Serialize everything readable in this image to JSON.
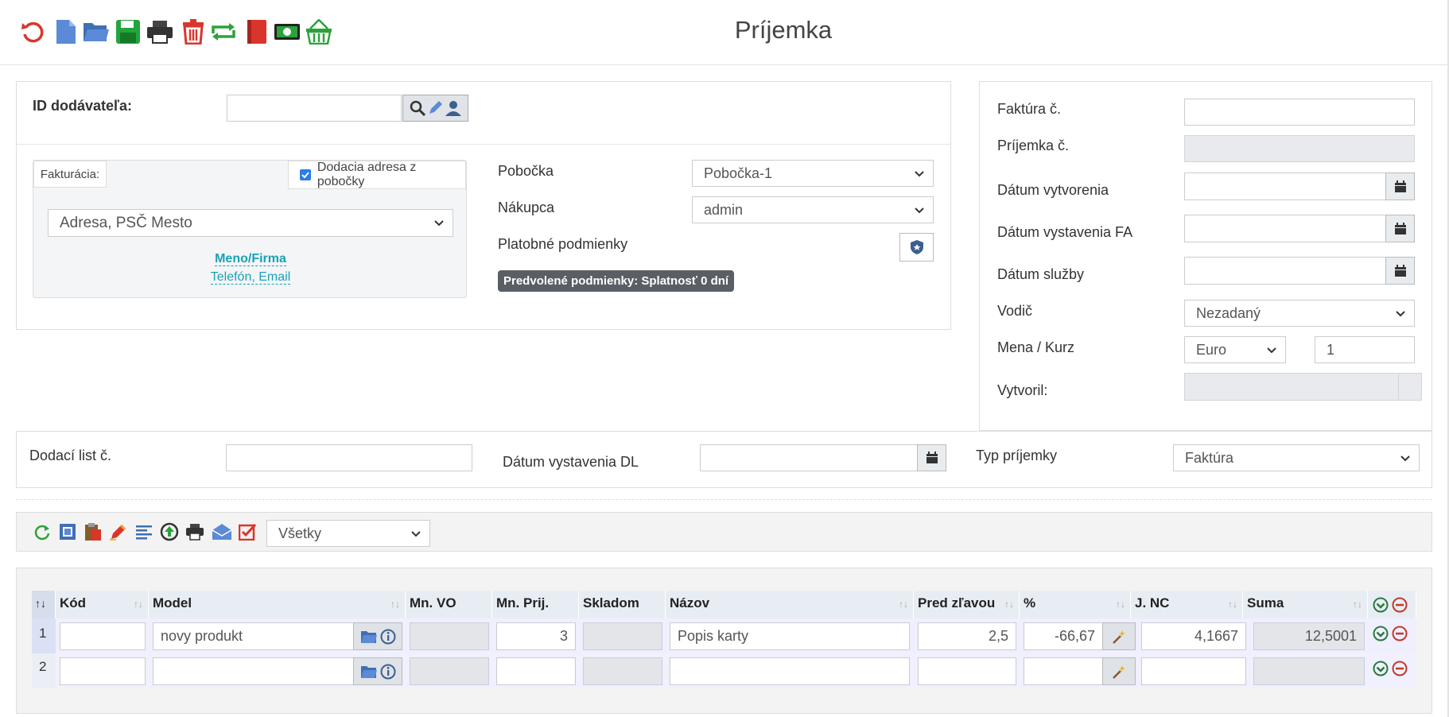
{
  "header": {
    "title": "Príjemka"
  },
  "toolbar_icons": [
    "refresh-icon",
    "new-document-icon",
    "open-folder-icon",
    "save-icon",
    "print-icon",
    "delete-icon",
    "convert-icon",
    "book-icon",
    "money-icon",
    "basket-icon"
  ],
  "supplier": {
    "label": "ID dodávateľa:",
    "value": ""
  },
  "billing": {
    "tab_label": "Fakturácia:",
    "delivery_checkbox_label": "Dodacia adresa z pobočky",
    "delivery_checked": true,
    "address_selected": "Adresa, PSČ Mesto",
    "name_link": "Meno/Firma",
    "contact_link": "Telefón, Email"
  },
  "branch": {
    "branch_label": "Pobočka",
    "branch_value": "Pobočka-1",
    "buyer_label": "Nákupca",
    "buyer_value": "admin",
    "payment_label": "Platobné podmienky",
    "payment_badge": "Predvolené podmienky: Splatnosť 0 dní"
  },
  "invoice": {
    "invoice_no_label": "Faktúra č.",
    "receipt_no_label": "Príjemka č.",
    "created_label": "Dátum vytvorenia",
    "issued_label": "Dátum vystavenia FA",
    "service_label": "Dátum služby",
    "driver_label": "Vodič",
    "driver_value": "Nezadaný",
    "currency_label": "Mena / Kurz",
    "currency_value": "Euro",
    "rate_value": "1",
    "created_by_label": "Vytvoril:"
  },
  "delivery": {
    "dl_label": "Dodací list č.",
    "dl_date_label": "Dátum vystavenia DL",
    "type_label": "Typ príjemky",
    "type_value": "Faktúra"
  },
  "items_toolbar": {
    "filter_value": "Všetky"
  },
  "table": {
    "columns": [
      "Kód",
      "Model",
      "Mn. VO",
      "Mn. Prij.",
      "Skladom",
      "Názov",
      "Pred zľavou",
      "%",
      "J. NC",
      "Suma"
    ],
    "rows": [
      {
        "num": "1",
        "kod": "",
        "model": "novy produkt",
        "mn_vo": "",
        "mn_prij": "3",
        "skladom": "",
        "nazov": "Popis karty",
        "pred_zlavou": "2,5",
        "percent": "-66,67",
        "j_nc": "4,1667",
        "suma": "12,5001"
      },
      {
        "num": "2",
        "kod": "",
        "model": "",
        "mn_vo": "",
        "mn_prij": "",
        "skladom": "",
        "nazov": "",
        "pred_zlavou": "",
        "percent": "",
        "j_nc": "",
        "suma": ""
      }
    ]
  },
  "colors": {
    "accent": "#17a2b8",
    "green": "#28a745",
    "red": "#dc3545",
    "blue_icon": "#5b8ad6"
  }
}
